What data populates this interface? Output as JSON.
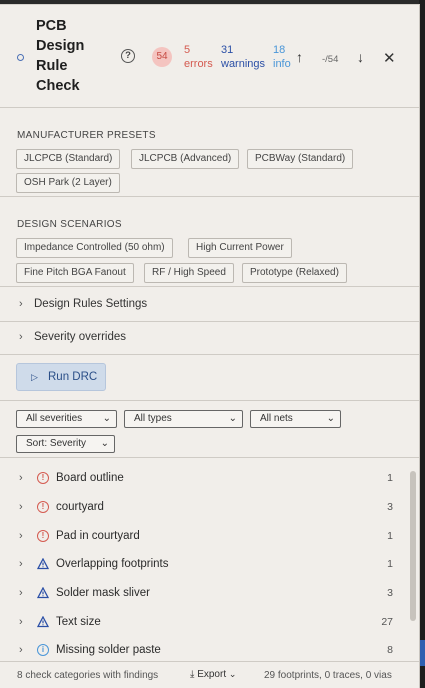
{
  "header": {
    "title": "PCB Design Rule Check",
    "help_glyph": "?",
    "total": "54",
    "errors_count": "5",
    "errors_label": "errors",
    "warnings_count": "31",
    "warnings_label": "warnings",
    "info_count": "18",
    "info_label": "info",
    "nav_position": "-/54"
  },
  "presets": {
    "title": "MANUFACTURER PRESETS",
    "items": [
      "JLCPCB (Standard)",
      "JLCPCB (Advanced)",
      "PCBWay (Standard)",
      "OSH Park (2 Layer)"
    ]
  },
  "scenarios": {
    "title": "DESIGN SCENARIOS",
    "items": [
      "Impedance Controlled (50 ohm)",
      "High Current Power",
      "Fine Pitch BGA Fanout",
      "RF / High Speed",
      "Prototype (Relaxed)"
    ]
  },
  "sections": {
    "rules_settings": "Design Rules Settings",
    "severity_overrides": "Severity overrides"
  },
  "run_button": {
    "label": "Run DRC"
  },
  "filters": {
    "severity": "All severities",
    "types": "All types",
    "nets": "All nets",
    "sort": "Sort: Severity"
  },
  "findings": [
    {
      "label": "Board outline",
      "severity": "error",
      "count": "1"
    },
    {
      "label": "courtyard",
      "severity": "error",
      "count": "3"
    },
    {
      "label": "Pad in courtyard",
      "severity": "error",
      "count": "1"
    },
    {
      "label": "Overlapping footprints",
      "severity": "warning",
      "count": "1"
    },
    {
      "label": "Solder mask sliver",
      "severity": "warning",
      "count": "3"
    },
    {
      "label": "Text size",
      "severity": "warning",
      "count": "27"
    },
    {
      "label": "Missing solder paste",
      "severity": "info",
      "count": "8"
    }
  ],
  "footer": {
    "summary": "8 check categories with findings",
    "export_label": "Export",
    "stats": "29 footprints, 0 traces, 0 vias"
  },
  "colors": {
    "error": "#d45a50",
    "warning": "#2b4fa6",
    "info": "#4a96d8",
    "panel": "#f1eeea"
  }
}
